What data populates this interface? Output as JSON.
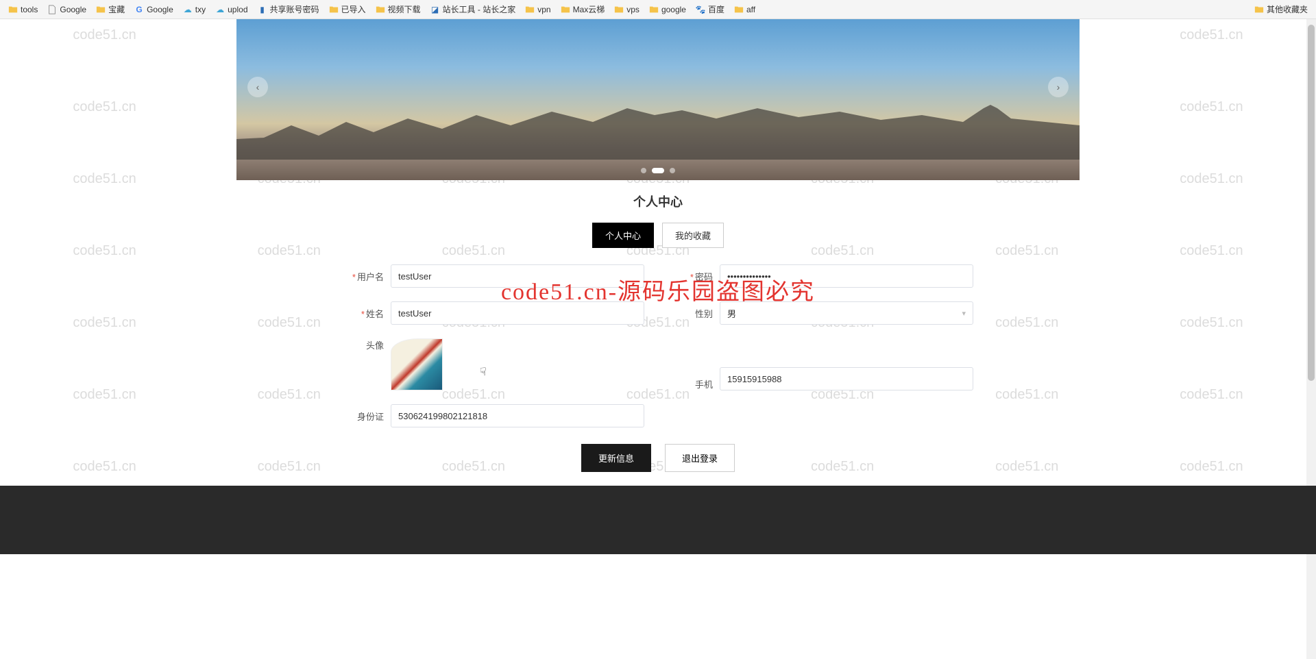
{
  "bookmarks": {
    "left": [
      {
        "label": "tools",
        "type": "folder"
      },
      {
        "label": "Google",
        "type": "page"
      },
      {
        "label": "宝藏",
        "type": "folder"
      },
      {
        "label": "Google",
        "type": "g"
      },
      {
        "label": "txy",
        "type": "cloud"
      },
      {
        "label": "uplod",
        "type": "cloud"
      },
      {
        "label": "共享账号密码",
        "type": "special"
      },
      {
        "label": "已导入",
        "type": "folder"
      },
      {
        "label": "视频下载",
        "type": "folder"
      },
      {
        "label": "站长工具 - 站长之家",
        "type": "special2"
      },
      {
        "label": "vpn",
        "type": "folder"
      },
      {
        "label": "Max云梯",
        "type": "folder"
      },
      {
        "label": "vps",
        "type": "folder"
      },
      {
        "label": "google",
        "type": "folder"
      },
      {
        "label": "百度",
        "type": "baidu"
      },
      {
        "label": "aff",
        "type": "folder"
      }
    ],
    "right": {
      "label": "其他收藏夹",
      "type": "folder"
    }
  },
  "watermark_text": "code51.cn",
  "red_overlay": "code51.cn-源码乐园盗图必究",
  "page_title": "个人中心",
  "tabs": [
    {
      "label": "个人中心",
      "active": true
    },
    {
      "label": "我的收藏",
      "active": false
    }
  ],
  "form": {
    "username": {
      "label": "用户名",
      "value": "testUser",
      "required": true
    },
    "password": {
      "label": "密码",
      "value": "••••••••••••••",
      "required": true
    },
    "realname": {
      "label": "姓名",
      "value": "testUser",
      "required": true
    },
    "gender": {
      "label": "性别",
      "value": "男"
    },
    "avatar": {
      "label": "头像"
    },
    "phone": {
      "label": "手机",
      "value": "15915915988"
    },
    "idcard": {
      "label": "身份证",
      "value": "530624199802121818"
    }
  },
  "actions": {
    "update": "更新信息",
    "logout": "退出登录"
  }
}
